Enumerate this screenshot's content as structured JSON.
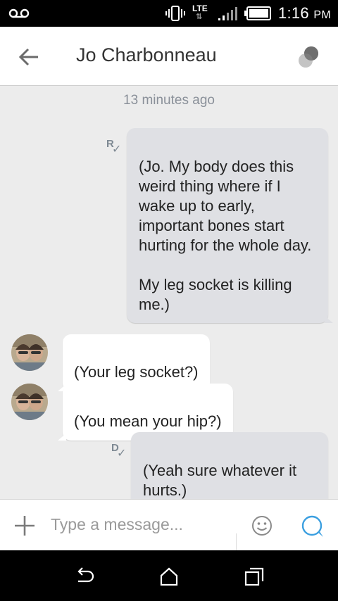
{
  "status_bar": {
    "network": "LTE",
    "network_arrows": "⇅",
    "time": "1:16",
    "time_suffix": "PM",
    "icons": [
      "voicemail-icon",
      "vibrate-icon",
      "lte-icon",
      "signal-icon",
      "battery-icon"
    ]
  },
  "header": {
    "contact_name": "Jo Charbonneau",
    "back_icon": "arrow-left-icon",
    "contact_icon": "contact-status-dot-icon"
  },
  "conversation": {
    "timestamp": "13 minutes ago",
    "messages": [
      {
        "direction": "outgoing",
        "receipt": "R",
        "text": "(Jo. My body does this weird thing where if I wake up to early, important bones start hurting for the whole day.\n\nMy leg socket is killing me.)"
      },
      {
        "direction": "incoming",
        "text": "(Your leg socket?)"
      },
      {
        "direction": "incoming",
        "text": "(You mean your hip?)"
      },
      {
        "direction": "outgoing",
        "receipt": "D",
        "text": "(Yeah sure whatever it hurts.)"
      }
    ]
  },
  "composer": {
    "placeholder": "Type a message...",
    "add_icon": "plus-icon",
    "emoji_icon": "smiley-icon",
    "send_icon": "send-bubble-icon"
  },
  "nav_bar": {
    "icons": [
      "back-icon",
      "home-icon",
      "recents-icon"
    ]
  },
  "colors": {
    "outgoing_bubble": "#dfe0e4",
    "incoming_bubble": "#ffffff",
    "background": "#ececec",
    "send_accent": "#3b9fe0"
  }
}
